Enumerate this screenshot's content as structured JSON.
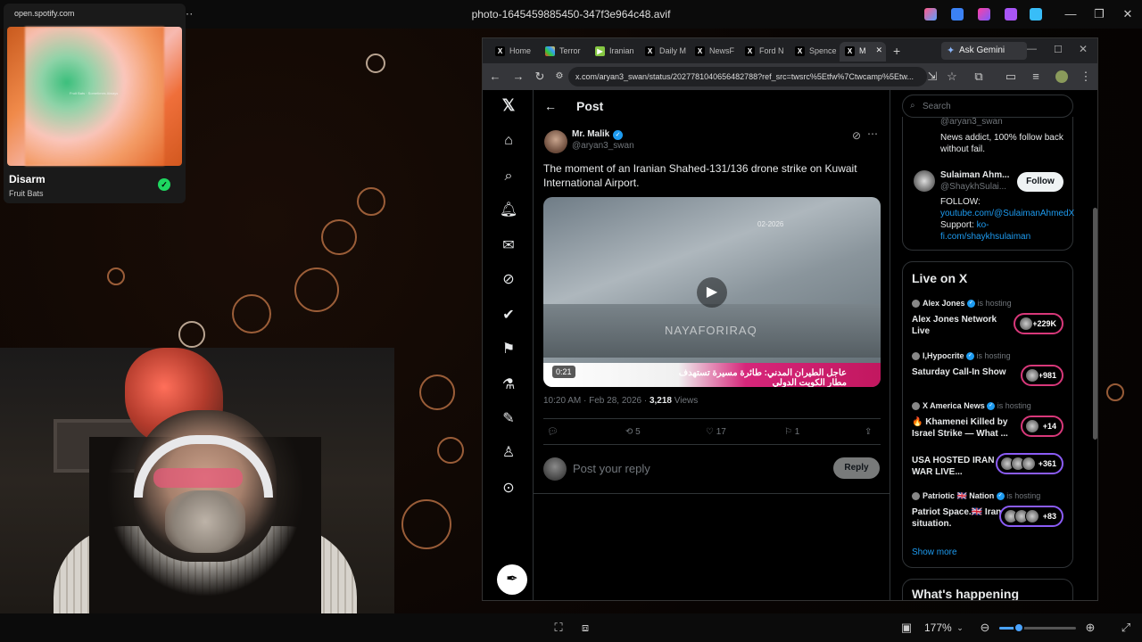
{
  "viewer": {
    "title": "photo-1645459885450-347f3e964c48.avif",
    "zoom": "177%"
  },
  "spotify": {
    "url": "open.spotify.com",
    "track": "Disarm",
    "artist": "Fruit Bats",
    "art_text": "Fruit Bats · Sometimes Always"
  },
  "browser": {
    "tabs": [
      {
        "label": "Home",
        "icon": "x-logo"
      },
      {
        "label": "Terror",
        "icon": "pinwheel"
      },
      {
        "label": "Iranian",
        "icon": "rumble"
      },
      {
        "label": "Daily M",
        "icon": "x-logo"
      },
      {
        "label": "NewsF",
        "icon": "x-logo"
      },
      {
        "label": "Ford N",
        "icon": "x-logo"
      },
      {
        "label": "Spence",
        "icon": "x-logo"
      },
      {
        "label": "M",
        "icon": "x-logo"
      }
    ],
    "ask_gemini": "Ask Gemini",
    "url": "x.com/aryan3_swan/status/2027781040656482788?ref_src=twsrc%5Etfw%7Ctwcamp%5Etw..."
  },
  "post": {
    "header": "Post",
    "author_name": "Mr. Malik",
    "author_handle": "@aryan3_swan",
    "text": "The moment of an Iranian Shahed-131/136 drone strike on Kuwait International Airport.",
    "video": {
      "duration": "0:21",
      "watermark": "NAYAFORIRAQ",
      "caption": "عاجل الطيران المدني: طائرة مسيرة تستهدف مطار الكويت الدولي",
      "date": "02-2026"
    },
    "time": "10:20 AM · Feb 28, 2026 · ",
    "views_count": "3,218",
    "views_label": " Views",
    "reposts": "5",
    "likes": "17",
    "bookmarks": "1",
    "reply_placeholder": "Post your reply",
    "reply_button": "Reply"
  },
  "sidebar": {
    "search_placeholder": "Search",
    "who_to_follow": [
      {
        "handle": "@aryan3_swan",
        "bio": "News addict, 100% follow back without fail."
      },
      {
        "name": "Sulaiman Ahm...",
        "handle": "@ShaykhSulai...",
        "follow": "Follow",
        "bio_prefix": "FOLLOW:",
        "bio_link1": "youtube.com/@SulaimanAhmedX",
        "bio_mid": " Support: ",
        "bio_link2": "ko-fi.com/shaykhsulaiman"
      }
    ],
    "live_title": "Live on X",
    "live": [
      {
        "host": "Alex Jones",
        "show": "Alex Jones Network Live",
        "count": "+229K"
      },
      {
        "host": "I,Hypocrite",
        "show": "Saturday Call-In Show",
        "count": "+981"
      },
      {
        "host": "X America News",
        "show": "🔥 Khamenei Killed by Israel Strike — What ...",
        "count": "+14"
      },
      {
        "host": "",
        "show": "USA HOSTED IRAN WAR LIVE...",
        "count": "+361"
      },
      {
        "host": "Patriotic 🇬🇧 Nation",
        "show": "Patriot Space.🇬🇧 Iran situation.",
        "count": "+83"
      }
    ],
    "is_hosting": "is hosting",
    "show_more": "Show more",
    "happening_title": "What's happening"
  }
}
